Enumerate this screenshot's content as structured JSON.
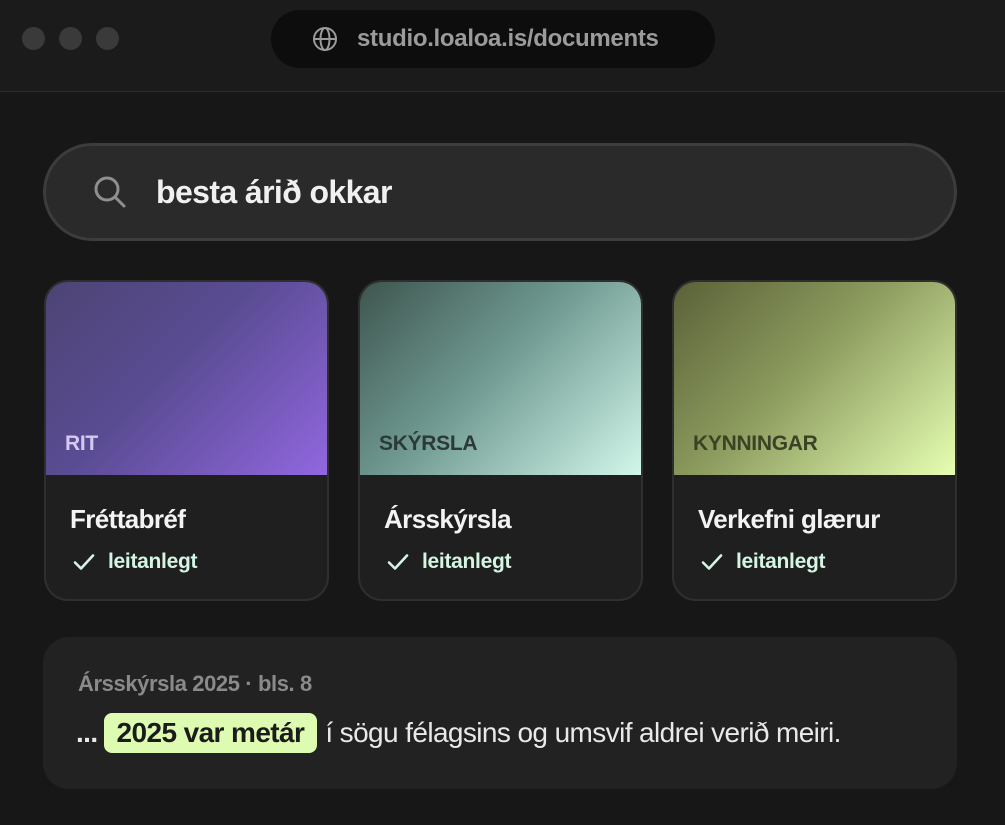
{
  "browser": {
    "url": "studio.loaloa.is/documents",
    "url_icon": "globe-icon"
  },
  "search": {
    "query": "besta árið okkar",
    "icon": "search-icon"
  },
  "cards": [
    {
      "category": "RIT",
      "title": "Fréttabréf",
      "status": "leitanlegt",
      "status_icon": "check-icon",
      "accent": "#9167e0"
    },
    {
      "category": "SKÝRSLA",
      "title": "Ársskýrsla",
      "status": "leitanlegt",
      "status_icon": "check-icon",
      "accent": "#d2f6ea"
    },
    {
      "category": "KYNNINGAR",
      "title": "Verkefni glærur",
      "status": "leitanlegt",
      "status_icon": "check-icon",
      "accent": "#e6ffb3"
    }
  ],
  "result": {
    "meta": "Ársskýrsla 2025 · bls. 8",
    "prefix": "...",
    "highlight": "2025 var metár",
    "suffix": "í sögu félagsins og umsvif aldrei verið meiri.",
    "highlight_color": "#ddfbb1"
  }
}
